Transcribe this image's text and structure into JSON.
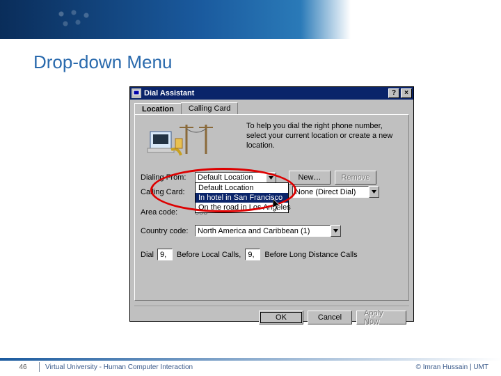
{
  "slide": {
    "title": "Drop-down Menu",
    "page_number": "46",
    "footer_course": "Virtual University - Human Computer Interaction",
    "footer_copy": "© Imran Hussain | UMT"
  },
  "dialog": {
    "title": "Dial Assistant",
    "titlebar": {
      "help": "?",
      "close": "×"
    },
    "tabs": {
      "location": "Location",
      "calling_card": "Calling Card"
    },
    "help_text": "To help you dial the right phone number, select your current location or create a new location.",
    "labels": {
      "dialing_from": "Dialing From:",
      "calling_card": "Calling Card:",
      "area_code": "Area code:",
      "country_code": "Country code:",
      "dial": "Dial",
      "before_local": "Before Local Calls,",
      "before_long": "Before Long Distance Calls"
    },
    "values": {
      "dialing_from": "Default Location",
      "calling_card": "None (Direct Dial)",
      "area_code": "888",
      "country_code": "North America and Caribbean (1)",
      "local_prefix": "9,",
      "long_prefix": "9,"
    },
    "dropdown_options": {
      "opt1": "Default Location",
      "opt2": "In hotel in San Francisco",
      "opt3": "On the road in Los Angeles"
    },
    "buttons": {
      "new": "New…",
      "remove": "Remove",
      "ok": "OK",
      "cancel": "Cancel",
      "apply": "Apply Now"
    }
  }
}
